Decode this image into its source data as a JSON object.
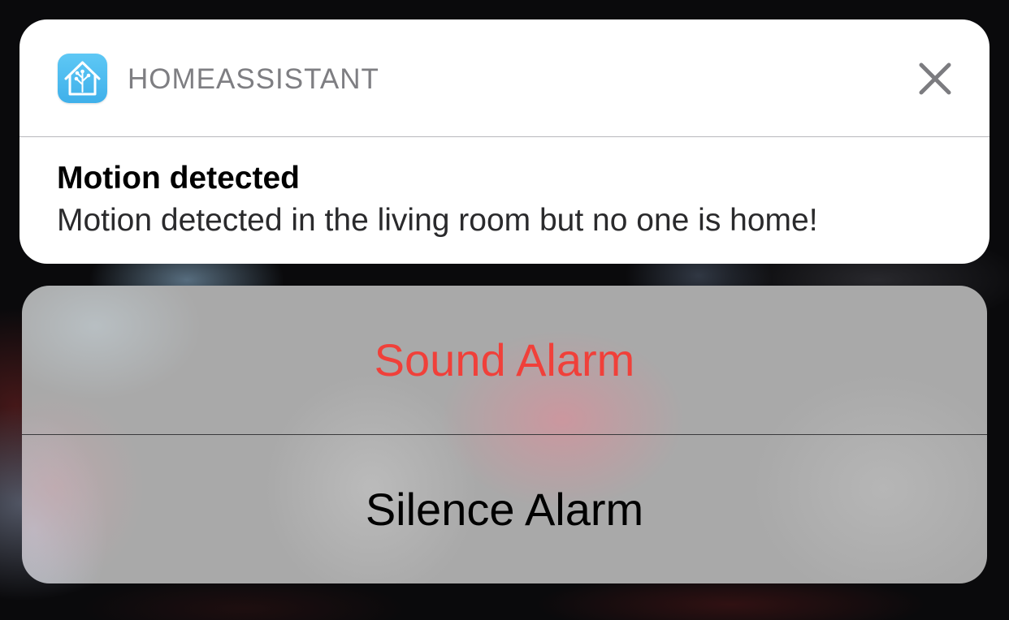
{
  "notification": {
    "app_name": "HOMEASSISTANT",
    "app_icon": "home-assistant-icon",
    "close_icon": "close-icon",
    "title": "Motion detected",
    "body": "Motion detected in the living room but no one is home!"
  },
  "actions": {
    "sound_alarm": "Sound Alarm",
    "silence_alarm": "Silence Alarm"
  },
  "colors": {
    "destructive_action": "#f0403a",
    "app_icon": "#41bdf5"
  }
}
